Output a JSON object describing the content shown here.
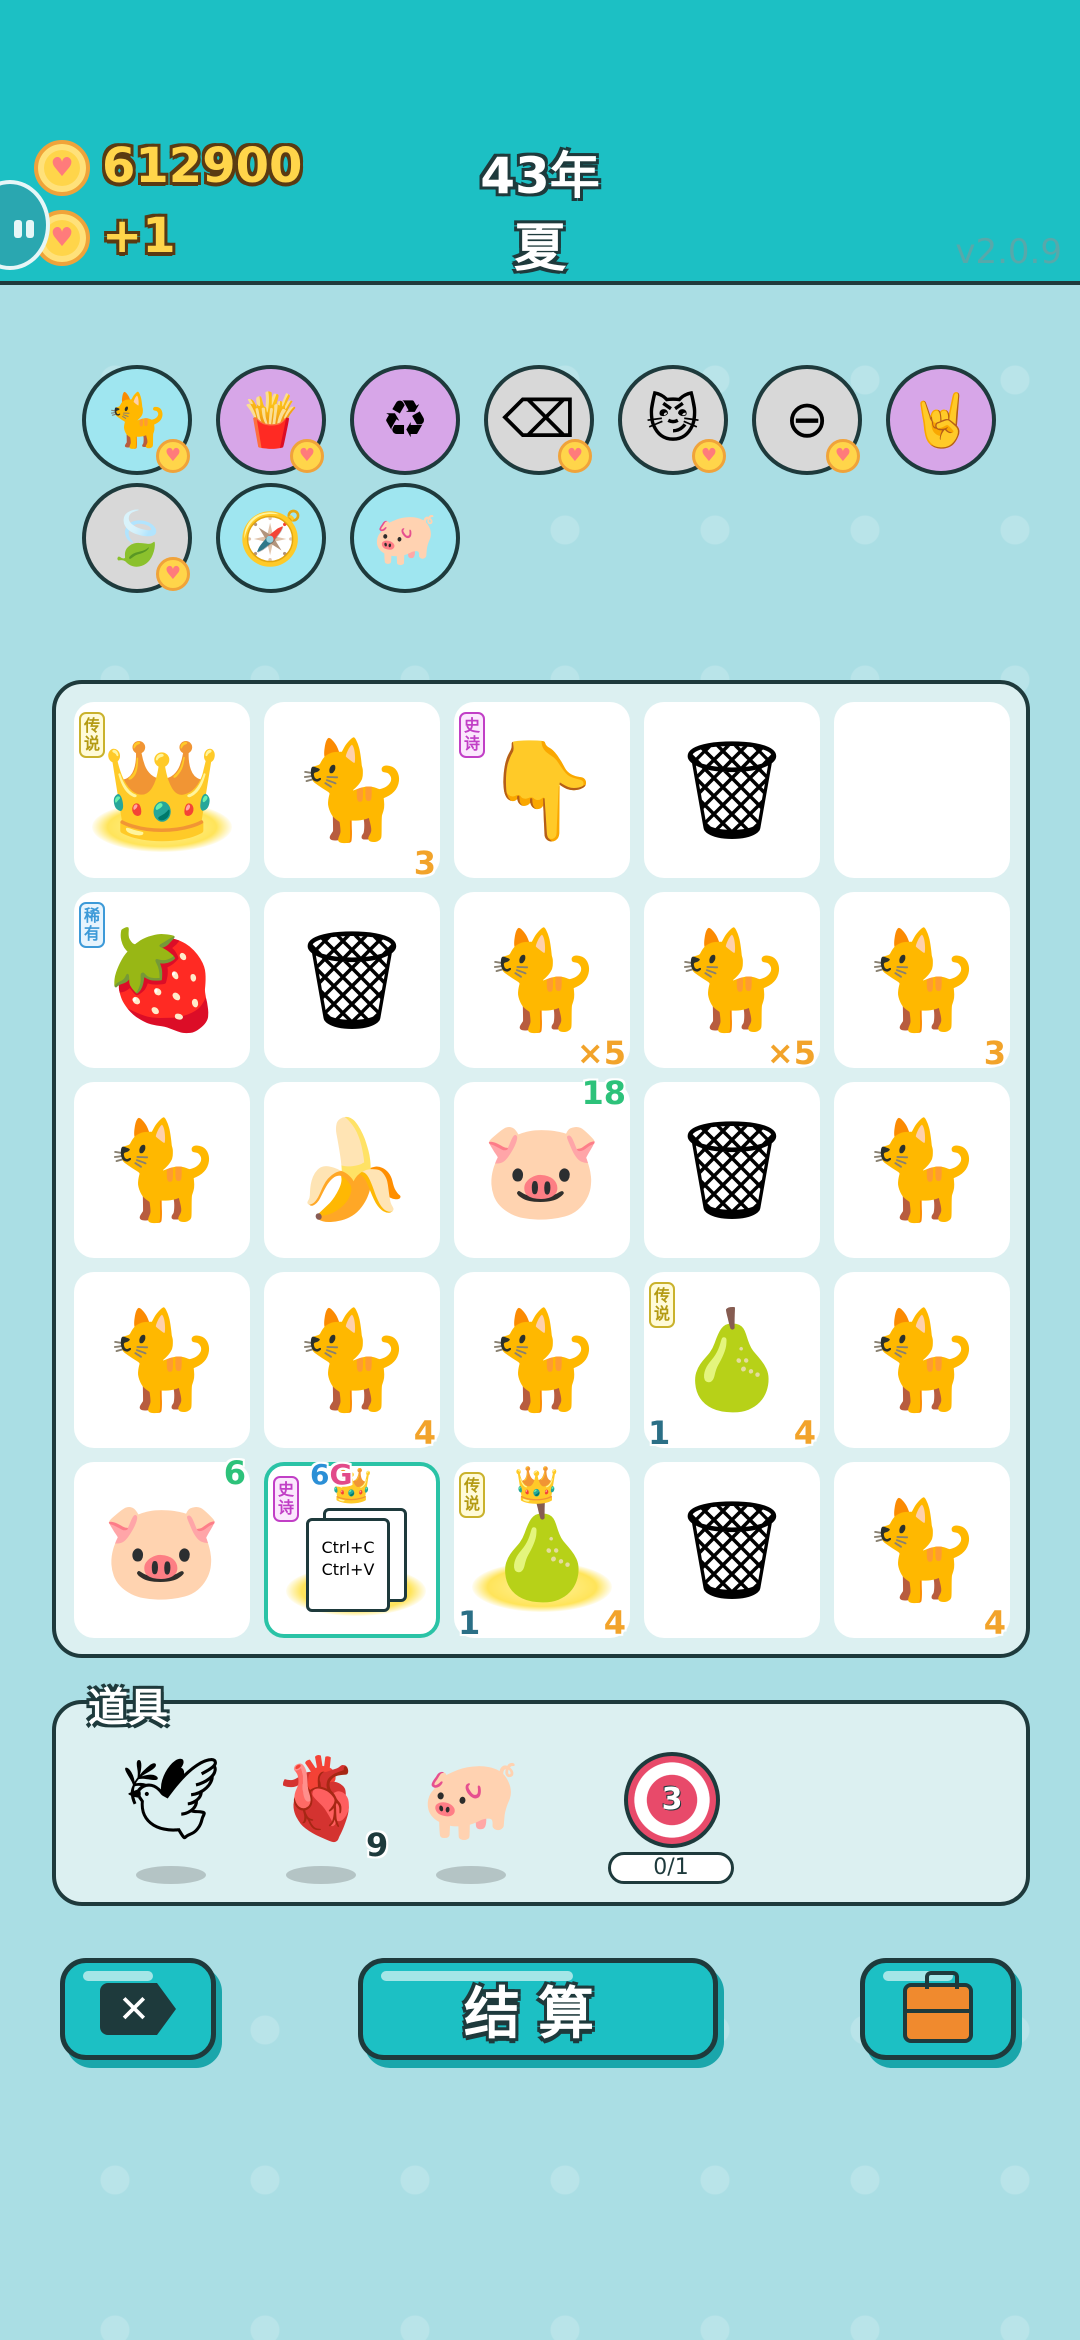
{
  "header": {
    "coins": "612900",
    "coin_gain": "+1",
    "year": "43年",
    "season": "夏",
    "version": "v2.0.9"
  },
  "relics": [
    {
      "name": "cat-portrait",
      "glyph": "🐈",
      "bg": "#9fe6f0",
      "has_coin": true
    },
    {
      "name": "fries",
      "glyph": "🍟",
      "bg": "#d7a6e8",
      "has_coin": true
    },
    {
      "name": "recycle",
      "glyph": "♻",
      "bg": "#d7a6e8",
      "has_coin": false
    },
    {
      "name": "remove-tag",
      "glyph": "⌫",
      "bg": "#d8d8d8",
      "has_coin": true
    },
    {
      "name": "cat-eyes",
      "glyph": "😼",
      "bg": "#d8d8d8",
      "has_coin": true
    },
    {
      "name": "minus",
      "glyph": "⊖",
      "bg": "#d8d8d8",
      "has_coin": true
    },
    {
      "name": "rock-hand",
      "glyph": "🤘",
      "bg": "#d7a6e8",
      "has_coin": false
    },
    {
      "name": "leaf",
      "glyph": "🍃",
      "bg": "#d8d8d8",
      "has_coin": true
    },
    {
      "name": "compass",
      "glyph": "🧭",
      "bg": "#9fe6f0",
      "has_coin": false
    },
    {
      "name": "piggy-bank",
      "glyph": "🐖",
      "bg": "#9fe6f0",
      "has_coin": false
    }
  ],
  "board": [
    {
      "kind": "king",
      "glyph": "👑",
      "tag": "传说",
      "tagtype": "leg",
      "glow": true
    },
    {
      "kind": "cat",
      "glyph": "🐈",
      "br": "3"
    },
    {
      "kind": "hand",
      "glyph": "👇",
      "tag": "史诗",
      "tagtype": "epic"
    },
    {
      "kind": "trash",
      "glyph": "🗑"
    },
    {
      "kind": "empty",
      "glyph": ""
    },
    {
      "kind": "lychee",
      "glyph": "🍓",
      "tag": "稀有",
      "tagtype": "rare"
    },
    {
      "kind": "trash",
      "glyph": "🗑"
    },
    {
      "kind": "cat",
      "glyph": "🐈",
      "br": "×5"
    },
    {
      "kind": "cat",
      "glyph": "🐈",
      "br": "×5"
    },
    {
      "kind": "cat",
      "glyph": "🐈",
      "br": "3"
    },
    {
      "kind": "cat",
      "glyph": "🐈"
    },
    {
      "kind": "banana",
      "glyph": "🍌"
    },
    {
      "kind": "pig",
      "glyph": "🐷",
      "tr": "18"
    },
    {
      "kind": "trash",
      "glyph": "🗑"
    },
    {
      "kind": "cat",
      "glyph": "🐈"
    },
    {
      "kind": "cat-sleep",
      "glyph": "🐈"
    },
    {
      "kind": "cat",
      "glyph": "🐈",
      "br": "4"
    },
    {
      "kind": "cat",
      "glyph": "🐈"
    },
    {
      "kind": "pear",
      "glyph": "🍐",
      "tag": "传说",
      "tagtype": "leg",
      "bl": "1",
      "br": "4"
    },
    {
      "kind": "cat",
      "glyph": "🐈"
    },
    {
      "kind": "pig",
      "glyph": "🐷",
      "tr": "6"
    },
    {
      "kind": "copy-paste",
      "glyph": "",
      "tag": "史诗",
      "tagtype": "epic",
      "top": "6G",
      "card_line1": "Ctrl+C",
      "card_line2": "Ctrl+V",
      "selected": true,
      "glow": true
    },
    {
      "kind": "pear-crown",
      "glyph": "🍐",
      "tag": "传说",
      "tagtype": "leg",
      "bl": "1",
      "br": "4",
      "glow": true
    },
    {
      "kind": "trash",
      "glyph": "🗑"
    },
    {
      "kind": "cat",
      "glyph": "🐈",
      "br": "4"
    }
  ],
  "items": {
    "label": "道具",
    "list": [
      {
        "name": "bird",
        "glyph": "🕊",
        "count": ""
      },
      {
        "name": "liver",
        "glyph": "🫀",
        "count": "9"
      },
      {
        "name": "piggy-bank",
        "glyph": "🐖",
        "count": ""
      }
    ],
    "target": {
      "value": "3",
      "progress": "0/1"
    }
  },
  "buttons": {
    "remove_glyph": "✕",
    "settle": "结算",
    "bag_glyph": ""
  }
}
